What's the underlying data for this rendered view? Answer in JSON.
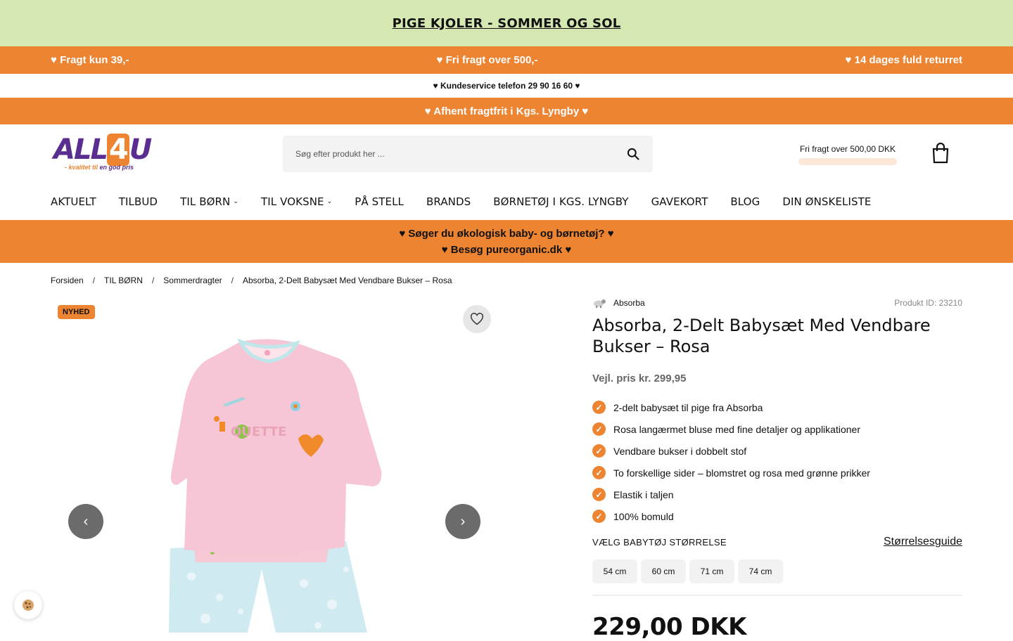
{
  "promo_top": {
    "text": "PIGE KJOLER - SOMMER OG SOL"
  },
  "usp_bar": {
    "left": "♥ Fragt kun 39,-",
    "center": "♥ Fri fragt over 500,-",
    "right": "♥ 14 dages fuld returret"
  },
  "service_bar": {
    "text": "♥ Kundeservice telefon 29 90 16 60 ♥"
  },
  "pickup_bar": {
    "text": "♥ Afhent fragtfrit i Kgs. Lyngby ♥"
  },
  "header": {
    "logo_text_main": "ALL",
    "logo_text_four": "4",
    "logo_text_end": "U",
    "logo_tagline_prefix": "- kvalitet til ",
    "logo_tagline_suffix": "en god pris",
    "search_placeholder": "Søg efter produkt her ...",
    "free_shipping_text": "Fri fragt over 500,00 DKK",
    "free_shipping_progress": 0
  },
  "nav": {
    "items": [
      {
        "label": "AKTUELT"
      },
      {
        "label": "TILBUD"
      },
      {
        "label": "TIL BØRN",
        "chevron": "⌄"
      },
      {
        "label": "TIL VOKSNE",
        "chevron": "⌄"
      },
      {
        "label": "PÅ STELL"
      },
      {
        "label": "BRANDS"
      },
      {
        "label": "BØRNETØJ I KGS. LYNGBY"
      },
      {
        "label": "GAVEKORT"
      },
      {
        "label": "BLOG"
      },
      {
        "label": "DIN ØNSKELISTE"
      }
    ]
  },
  "organic_bar": {
    "line1": "♥ Søger du økologisk baby- og børnetøj? ♥",
    "line2": "♥ Besøg pureorganic.dk ♥"
  },
  "breadcrumb": {
    "items": [
      "Forsiden",
      "TIL BØRN",
      "Sommerdragter",
      "Absorba, 2-Delt Babysæt Med Vendbare Bukser – Rosa"
    ],
    "separator": "/"
  },
  "gallery": {
    "badge": "NYHED",
    "prev_icon": "‹",
    "next_icon": "›"
  },
  "product": {
    "brand": "Absorba",
    "product_id": "Produkt ID: 23210",
    "title": "Absorba, 2-Delt Babysæt Med Vendbare Bukser – Rosa",
    "vejl_price": "Vejl. pris kr. 299,95",
    "features": [
      "2-delt babysæt til pige fra Absorba",
      "Rosa langærmet bluse med fine detaljer og applikationer",
      "Vendbare bukser i dobbelt stof",
      "To forskellige sider – blomstret og rosa med grønne prikker",
      "Elastik i taljen",
      "100% bomuld"
    ],
    "size_label": "VÆLG BABYTØJ STØRRELSE",
    "size_guide": "Størrelsesguide",
    "sizes": [
      "54 cm",
      "60 cm",
      "71 cm",
      "74 cm"
    ],
    "price": "229,00 DKK"
  },
  "colors": {
    "accent": "#ed8432",
    "promo_green": "#d5e8b1",
    "brand_purple": "#5a2d91"
  }
}
